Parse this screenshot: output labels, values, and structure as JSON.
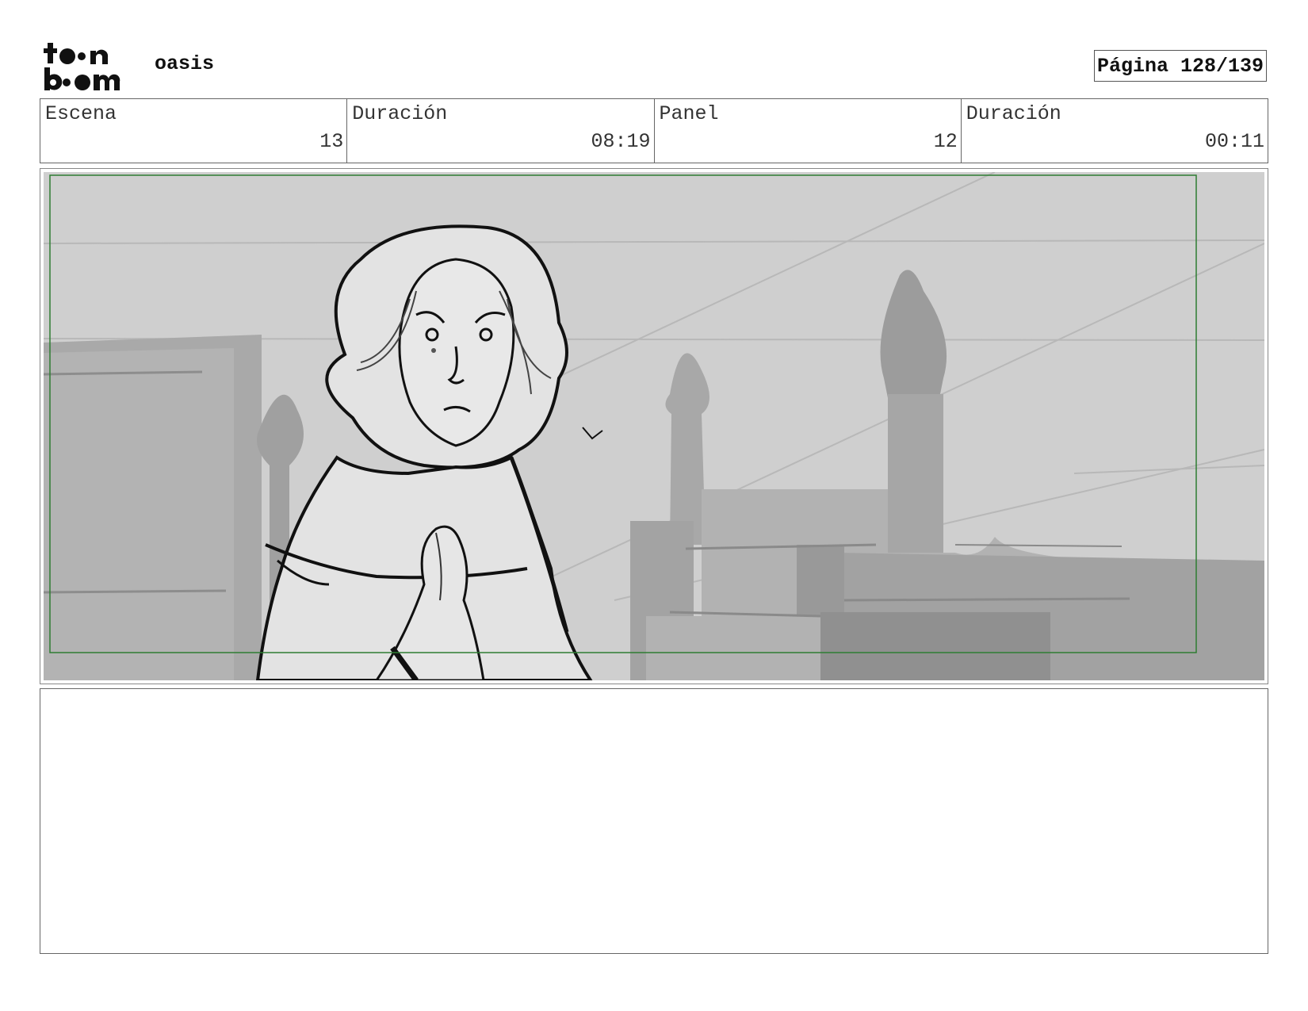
{
  "header": {
    "logo_text": "toon boom",
    "project_title": "oasis",
    "page_label": "Página 128/139"
  },
  "info": {
    "scene_label": "Escena",
    "scene_value": "13",
    "scene_duration_label": "Duración",
    "scene_duration_value": "08:19",
    "panel_label": "Panel",
    "panel_value": "12",
    "panel_duration_label": "Duración",
    "panel_duration_value": "00:11"
  },
  "colors": {
    "safe_frame": "#2e7d32",
    "sketch_bg": "#cfcfcf"
  },
  "notes": {
    "text": ""
  }
}
